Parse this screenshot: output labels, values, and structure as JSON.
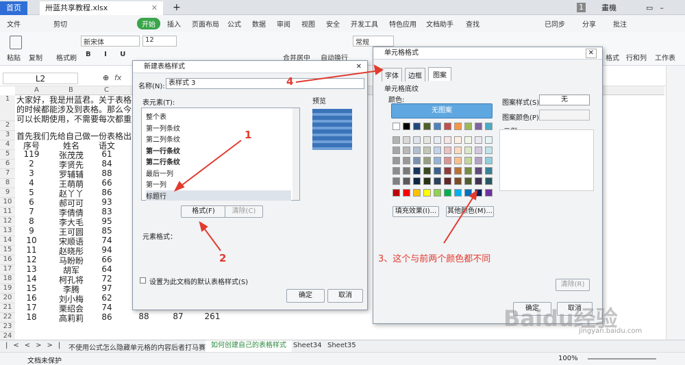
{
  "tabs": {
    "home": "首页",
    "file": "卅蓝共享教程.xlsx",
    "add": "+",
    "badge": "1",
    "user": "畫機"
  },
  "menu": [
    "文件",
    "剪切",
    "复制",
    "格式刷",
    "开始",
    "插入",
    "页面布局",
    "公式",
    "数据",
    "审阅",
    "视图",
    "安全",
    "开发工具",
    "特色应用",
    "文档助手",
    "查找"
  ],
  "menu_right": [
    "已同步",
    "分享",
    "批注"
  ],
  "ribbon": {
    "paste": "粘贴",
    "font": "新宋体",
    "size": "12",
    "merge": "合并居中",
    "wrap": "自动换行",
    "numfmt": "常规",
    "right": [
      "格式",
      "行和列",
      "工作表"
    ]
  },
  "fbar": {
    "cellref": "L2",
    "fx": "fx"
  },
  "cols": [
    "A",
    "B",
    "C"
  ],
  "intro": [
    "大家好，我是卅蓝君。关于表格",
    "的时候都能涉及到表格。那么今",
    "可以长期使用，不需要每次都重"
  ],
  "row2": "首先我们先给自己做一份表格出",
  "header": [
    "序号",
    "姓名",
    "语文"
  ],
  "rows": [
    [
      "119",
      "张茂茂",
      "61"
    ],
    [
      "2",
      "李贤先",
      "84"
    ],
    [
      "3",
      "罗辅辅",
      "88"
    ],
    [
      "4",
      "王萌萌",
      "66"
    ],
    [
      "5",
      "赵丫丫",
      "86"
    ],
    [
      "6",
      "郝可可",
      "93"
    ],
    [
      "7",
      "李倩倩",
      "83"
    ],
    [
      "8",
      "李大毛",
      "95"
    ],
    [
      "9",
      "王可圆",
      "85"
    ],
    [
      "10",
      "宋顺语",
      "74"
    ],
    [
      "11",
      "赵晓彤",
      "94"
    ],
    [
      "12",
      "马盼盼",
      "66"
    ],
    [
      "13",
      "胡军",
      "64"
    ],
    [
      "14",
      "柯孔将",
      "72"
    ],
    [
      "15",
      "李腾",
      "97"
    ],
    [
      "16",
      "刘小梅",
      "62"
    ],
    [
      "17",
      "栗绍会",
      "74"
    ],
    [
      "18",
      "高莉莉",
      "86"
    ]
  ],
  "row21_extra": [
    "88",
    "87",
    "261"
  ],
  "sheettabs": [
    "不使用公式怎么隐藏单元格的内容后者打马赛克",
    "如何创建自己的表格样式",
    "Sheet34",
    "Sheet35"
  ],
  "status": {
    "protect": "文档未保护",
    "zoom": "100%"
  },
  "dlg1": {
    "title": "新建表格样式",
    "name_label": "名称(N):",
    "name_value": "表样式 3",
    "elements_label": "表元素(T):",
    "preview_label": "预览",
    "items": [
      "整个表",
      "第一列条纹",
      "第二列条纹",
      "第一行条纹",
      "第二行条纹",
      "最后一列",
      "第一列",
      "标题行"
    ],
    "format_btn": "格式(F)",
    "clear_btn": "清除(C)",
    "elem_format": "元素格式：",
    "default_chk": "设置为此文档的默认表格样式(S)",
    "ok": "确定",
    "cancel": "取消"
  },
  "dlg2": {
    "title": "单元格格式",
    "tabs": [
      "字体",
      "边框",
      "图案"
    ],
    "section": "单元格底纹",
    "color_label": "颜色:",
    "no_pattern": "无图案",
    "pattern_style": "图案样式(S):",
    "pattern_style_val": "无",
    "pattern_color": "图案颜色(P):",
    "example": "示例",
    "fill_btn": "填充效果(I)...",
    "other_btn": "其他颜色(M)...",
    "clear_btn": "清除(R)",
    "ok": "确定",
    "cancel": "取消"
  },
  "annotations": {
    "a1": "1",
    "a2": "2",
    "a3": "3、这个与前两个颜色都不同",
    "a4": "4"
  },
  "watermark": "Baidu经验",
  "watermark_url": "jingyan.baidu.com",
  "colors": {
    "top": [
      "#ffffff",
      "#000000",
      "#1f497d",
      "#4f6228",
      "#4f81bd",
      "#c0504d",
      "#f79646",
      "#9bbb59",
      "#8064a2",
      "#4bacc6"
    ]
  }
}
